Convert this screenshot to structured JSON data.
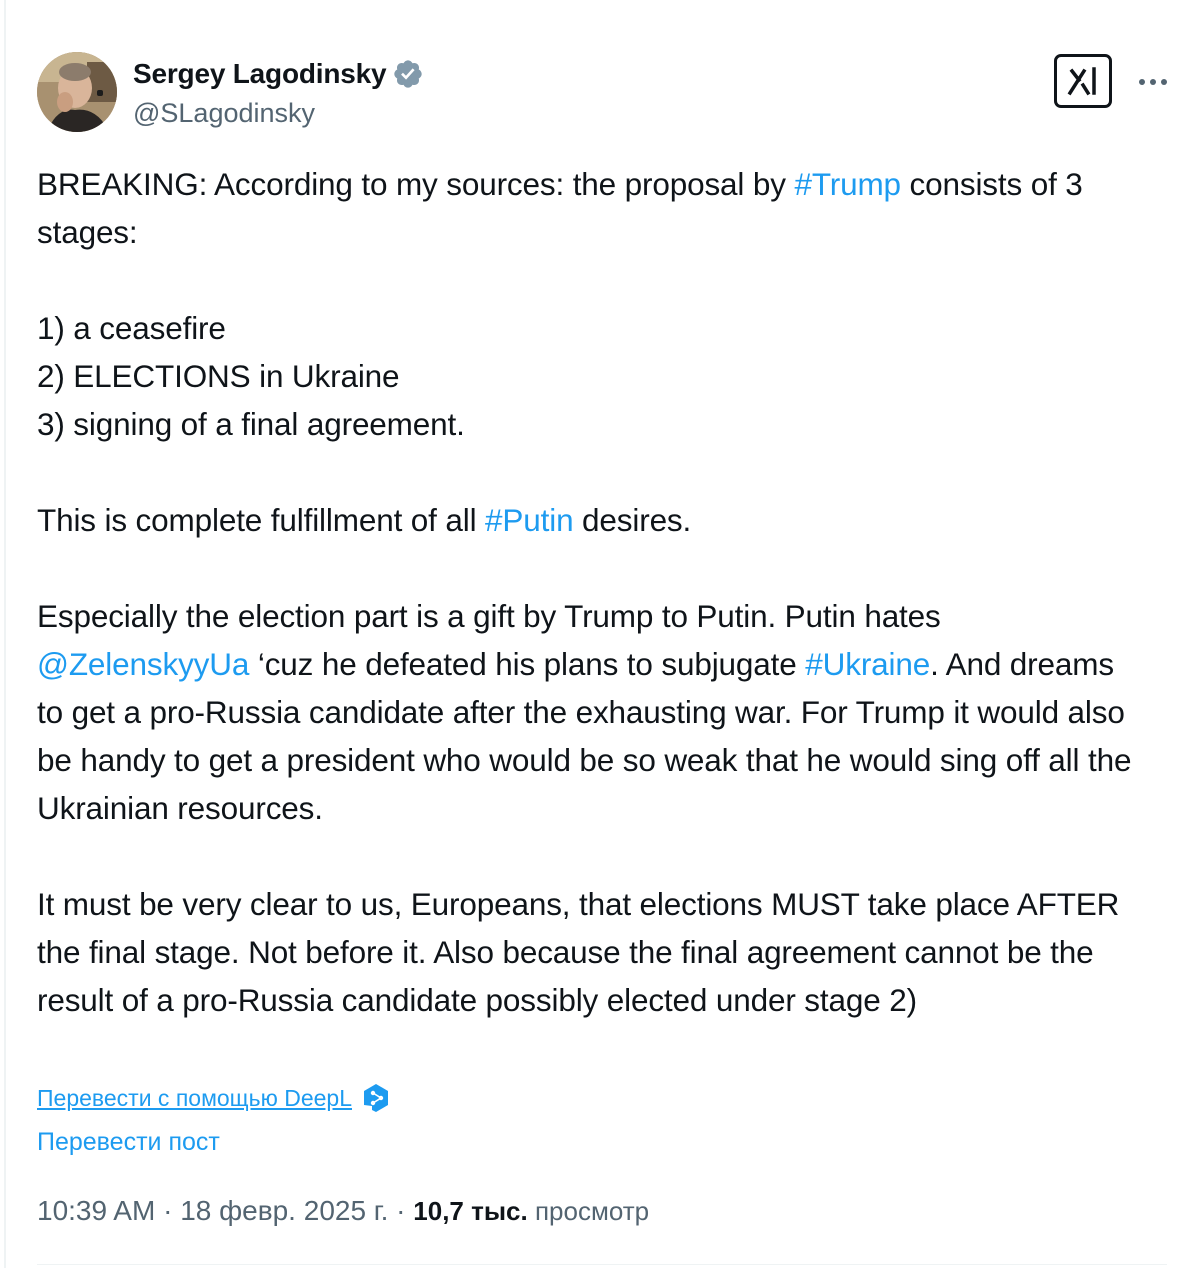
{
  "author": {
    "display_name": "Sergey Lagodinsky",
    "handle": "@SLagodinsky",
    "verified": true
  },
  "header": {
    "grok_icon": "grok-icon",
    "more_icon": "more-options-icon"
  },
  "tweet": {
    "line1_before": "BREAKING: According to my sources: the proposal by ",
    "hashtag_trump": "#Trump",
    "line1_after": " consists of 3 stages:",
    "stage1": "1) a ceasefire",
    "stage2": "2) ELECTIONS in Ukraine",
    "stage3": "3) signing of a final agreement.",
    "p3_before": "This is complete fulfillment of all ",
    "hashtag_putin": "#Putin",
    "p3_after": " desires.",
    "p4_part1": "Especially the election part is a gift by Trump to Putin. Putin hates ",
    "mention_zelensky": "@ZelenskyyUa",
    "p4_part2": " ‘cuz he defeated his plans to subjugate ",
    "hashtag_ukraine": "#Ukraine",
    "p4_part3": ". And dreams to get a pro-Russia candidate after the exhausting war. For Trump it would also be handy to get a president who would be so weak that he would sing off all the Ukrainian resources.",
    "p5": "It must be very clear to us, Europeans, that elections MUST take place AFTER the final stage. Not before it. Also because the final agreement cannot be the result of a pro-Russia candidate possibly elected under stage 2)"
  },
  "translation": {
    "deepl_label": "Перевести с помощью DeepL",
    "translate_post_label": "Перевести пост"
  },
  "meta": {
    "time": "10:39 AM",
    "separator": " · ",
    "date": "18 февр. 2025 г.",
    "views_count": "10,7 тыс.",
    "views_label": " просмотр"
  },
  "colors": {
    "link": "#1d9bf0",
    "text": "#0f1419",
    "secondary": "#536471",
    "verified": "#829aab"
  }
}
